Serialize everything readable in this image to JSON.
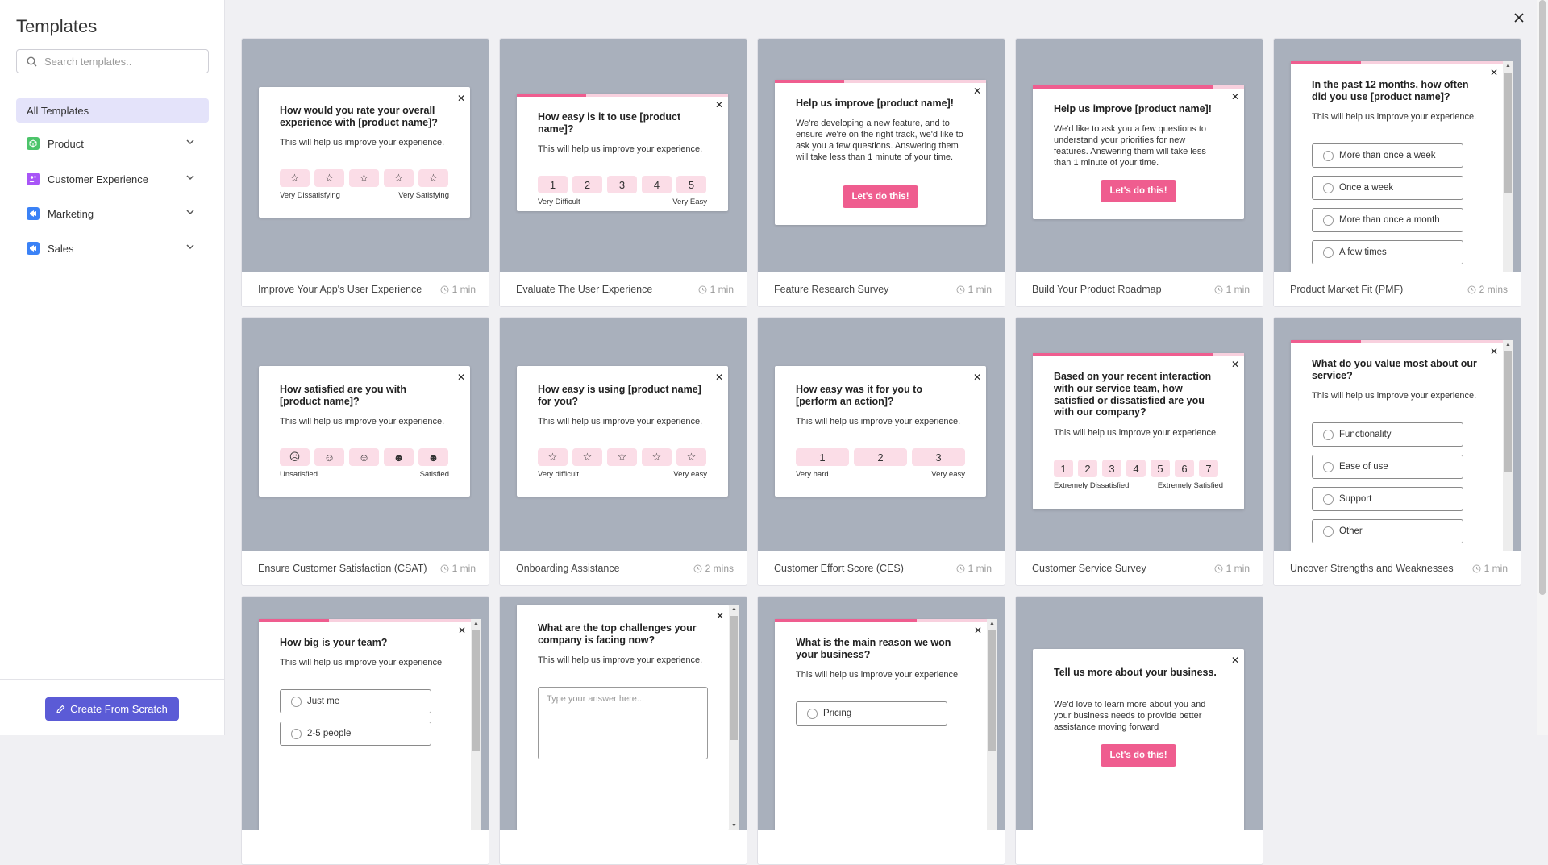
{
  "sidebar": {
    "title": "Templates",
    "search_placeholder": "Search templates..",
    "all_templates": "All Templates",
    "categories": [
      {
        "label": "Product",
        "icon": "box-icon",
        "color": "#4cc46a"
      },
      {
        "label": "Customer Experience",
        "icon": "users-icon",
        "color": "#a855f7"
      },
      {
        "label": "Marketing",
        "icon": "megaphone-icon",
        "color": "#3b82f6"
      },
      {
        "label": "Sales",
        "icon": "megaphone-icon",
        "color": "#3b82f6"
      }
    ],
    "create_button": "Create From Scratch"
  },
  "colors": {
    "accent": "#ef5d8f",
    "accent_light": "#fbdde7",
    "primary": "#5b5bd6",
    "preview_bg": "#a9b0bc"
  },
  "cards": [
    {
      "name": "Improve Your App's User Experience",
      "time": "1 min",
      "question": "How would you rate your overall experience with [product name]?",
      "sub": "This will help us improve your experience.",
      "scale": [
        "☆",
        "☆",
        "☆",
        "☆",
        "☆"
      ],
      "low": "Very Dissatisfying",
      "high": "Very Satisfying"
    },
    {
      "name": "Evaluate The User Experience",
      "time": "1 min",
      "question": "How easy is it to use [product name]?",
      "sub": "This will help us improve your experience.",
      "scale": [
        "1",
        "2",
        "3",
        "4",
        "5"
      ],
      "low": "Very Difficult",
      "high": "Very Easy"
    },
    {
      "name": "Feature Research Survey",
      "time": "1 min",
      "question": "Help us improve [product name]!",
      "sub": "We're developing a new feature, and to ensure we're on the right track, we'd like to ask you a few questions. Answering them will take less than 1 minute of your time.",
      "button": "Let's do this!"
    },
    {
      "name": "Build Your Product Roadmap",
      "time": "1 min",
      "question": "Help us improve [product name]!",
      "sub": "We'd like to ask you a few questions to understand your priorities for new features. Answering them will take less than 1 minute of your time.",
      "button": "Let's do this!"
    },
    {
      "name": "Product Market Fit (PMF)",
      "time": "2 mins",
      "question": "In the past 12 months, how often did you use [product name]?",
      "sub": "This will help us improve your experience.",
      "options": [
        "More than once a week",
        "Once a week",
        "More than once a month",
        "A few times"
      ]
    },
    {
      "name": "Ensure Customer Satisfaction (CSAT)",
      "time": "1 min",
      "question": "How satisfied are you with [product name]?",
      "sub": "This will help us improve your experience.",
      "scale": [
        "☹",
        "☺",
        "☺",
        "☻",
        "☻"
      ],
      "low": "Unsatisfied",
      "high": "Satisfied"
    },
    {
      "name": "Onboarding Assistance",
      "time": "2 mins",
      "question": "How easy is using [product name] for you?",
      "sub": "This will help us improve your experience.",
      "scale": [
        "☆",
        "☆",
        "☆",
        "☆",
        "☆"
      ],
      "low": "Very difficult",
      "high": "Very easy"
    },
    {
      "name": "Customer Effort Score (CES)",
      "time": "1 min",
      "question": "How easy was it for you to [perform an action]?",
      "sub": "This will help us improve your experience.",
      "scale": [
        "1",
        "2",
        "3"
      ],
      "low": "Very hard",
      "high": "Very easy"
    },
    {
      "name": "Customer Service Survey",
      "time": "1 min",
      "question": "Based on your recent interaction with our service team, how satisfied or dissatisfied are you with our company?",
      "sub": "This will help us improve your experience.",
      "scale": [
        "1",
        "2",
        "3",
        "4",
        "5",
        "6",
        "7"
      ],
      "low": "Extremely Dissatisfied",
      "high": "Extremely Satisfied"
    },
    {
      "name": "Uncover Strengths and Weaknesses",
      "time": "1 min",
      "question": "What do you value most about our service?",
      "sub": "This will help us improve your experience.",
      "options": [
        "Functionality",
        "Ease of use",
        "Support",
        "Other"
      ]
    },
    {
      "name": "",
      "time": "",
      "question": "How big is your team?",
      "sub": "This will help us improve your experience",
      "options": [
        "Just me",
        "2-5 people"
      ]
    },
    {
      "name": "",
      "time": "",
      "question": "What are the top challenges your company is facing now?",
      "sub": "This will help us improve your experience.",
      "placeholder": "Type your answer here..."
    },
    {
      "name": "",
      "time": "",
      "question": "What is the main reason we won your business?",
      "sub": "This will help us improve your experience",
      "options": [
        "Pricing"
      ]
    },
    {
      "name": "",
      "time": "",
      "question": "Tell us more about your business.",
      "sub": "We'd love to learn more about you and your business needs to provide better assistance moving forward",
      "button": "Let's do this!"
    }
  ]
}
